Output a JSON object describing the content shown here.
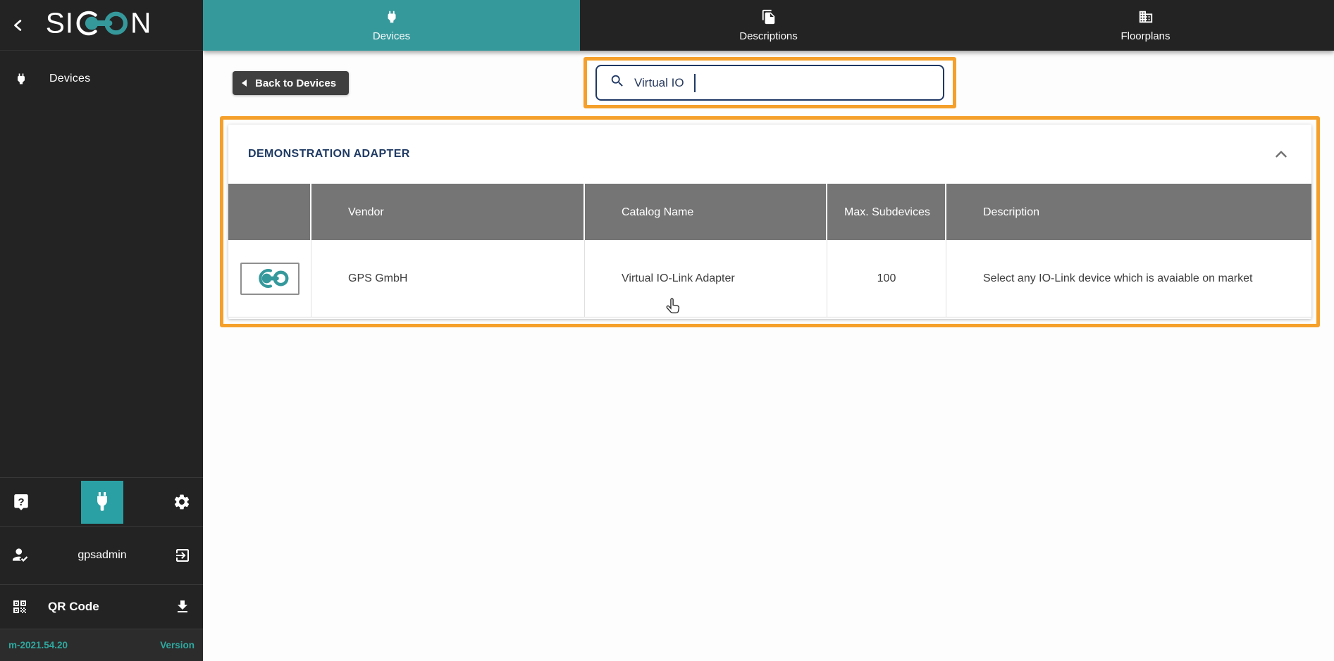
{
  "colors": {
    "accent_teal": "#35999C",
    "highlight_orange": "#F5A02B",
    "navy": "#1F3864"
  },
  "logo": {
    "left": "SI",
    "right": "N"
  },
  "tabs": [
    {
      "label": "Devices"
    },
    {
      "label": "Descriptions"
    },
    {
      "label": "Floorplans"
    }
  ],
  "sidebar": {
    "nav": [
      {
        "label": "Devices"
      }
    ],
    "help_glyph": "?",
    "user": {
      "name": "gpsadmin"
    },
    "qr_label": "QR Code",
    "version": {
      "value": "m-2021.54.20",
      "label": "Version"
    }
  },
  "toolbar": {
    "back_button": "Back to Devices"
  },
  "search": {
    "value": "Virtual IO"
  },
  "panel": {
    "title": "DEMONSTRATION ADAPTER",
    "table": {
      "columns": {
        "vendor": "Vendor",
        "catalog": "Catalog Name",
        "max_subdevices": "Max. Subdevices",
        "description": "Description"
      },
      "rows": [
        {
          "vendor": "GPS GmbH",
          "catalog": "Virtual IO-Link Adapter",
          "max_subdevices": "100",
          "description": "Select any IO-Link device which is avaiable on market"
        }
      ]
    }
  }
}
